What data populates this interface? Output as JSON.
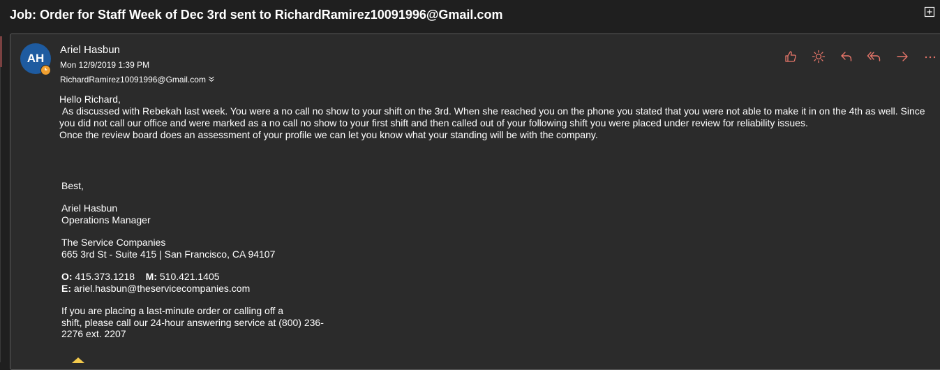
{
  "subject": "Job: Order for Staff Week of Dec 3rd sent to RichardRamirez10091996@Gmail.com",
  "message": {
    "avatar_initials": "AH",
    "sender": "Ariel Hasbun",
    "date": "Mon 12/9/2019 1:39 PM",
    "recipient": "RichardRamirez10091996@Gmail.com",
    "actions": [
      "like-icon",
      "brightness-icon",
      "reply-icon",
      "reply-all-icon",
      "forward-icon",
      "more-icon"
    ]
  },
  "body": {
    "greeting": "Hello Richard,",
    "paragraph1": " As discussed with Rebekah last week. You were a no call no show to your shift on the 3rd. When she reached you on the phone you stated that you were not able to make it in on the 4th as well. Since you did not call our office and were marked as a no call no show to your first shift and then called out of your following shift you were placed under review for reliability issues.",
    "paragraph2": "Once the review board does an assessment of your profile we can let you know what your standing will be with the company."
  },
  "signature": {
    "closing": "Best,",
    "name": "Ariel Hasbun",
    "title": "Operations Manager",
    "company": "The Service Companies",
    "address": "665 3rd St - Suite 415 | San Francisco, CA 94107",
    "office_label": "O:",
    "office_phone": "415.373.1218",
    "mobile_label": "M:",
    "mobile_phone": "510.421.1405",
    "email_label": "E:",
    "email": "ariel.hasbun@theservicecompanies.com",
    "notice_line1": "If you are placing a last-minute order or calling off a",
    "notice_line2": "shift, please call our 24-hour answering service at (800) 236-",
    "notice_line3": "2276 ext. 2207"
  },
  "colors": {
    "background": "#1f1f1f",
    "card": "#2b2b2b",
    "avatar": "#1e5ba0",
    "presence": "#f0a030",
    "action_icons": "#e8766a"
  }
}
